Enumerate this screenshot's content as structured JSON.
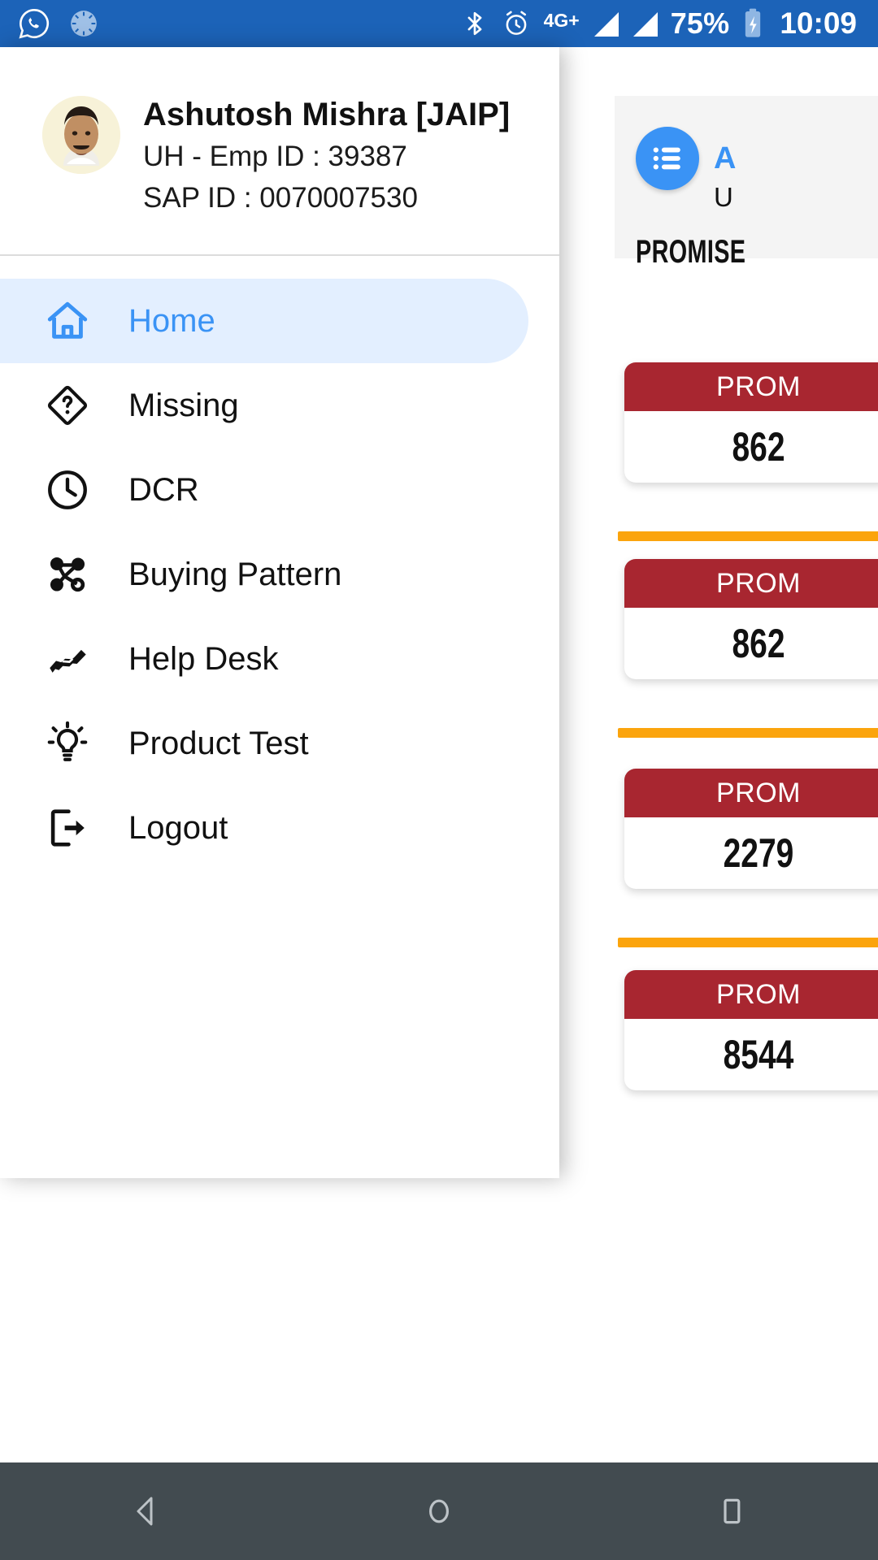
{
  "statusbar": {
    "whatsapp_icon": "whatsapp-icon",
    "spinner_icon": "sync-spinner-icon",
    "bluetooth_icon": "bluetooth-icon",
    "alarm_icon": "alarm-clock-icon",
    "network_type": "4G+",
    "battery_percent": "75%",
    "battery_icon": "battery-charging-icon",
    "clock": "10:09"
  },
  "drawer": {
    "profile": {
      "avatar": "user-avatar",
      "name": "Ashutosh Mishra [JAIP]",
      "emp_line": "UH - Emp ID : 39387",
      "sap_line": "SAP ID : 0070007530"
    },
    "items": [
      {
        "label": "Home",
        "icon": "home-icon",
        "active": true
      },
      {
        "label": "Missing",
        "icon": "help-diamond-icon",
        "active": false
      },
      {
        "label": "DCR",
        "icon": "clock-icon",
        "active": false
      },
      {
        "label": "Buying Pattern",
        "icon": "network-nodes-icon",
        "active": false
      },
      {
        "label": "Help Desk",
        "icon": "handshake-icon",
        "active": false
      },
      {
        "label": "Product Test",
        "icon": "lightbulb-icon",
        "active": false
      },
      {
        "label": "Logout",
        "icon": "logout-icon",
        "active": false
      }
    ]
  },
  "background": {
    "app_card": {
      "list_icon": "list-badge-icon",
      "title": "A",
      "subtitle": "U",
      "section_label": "PROMISE"
    },
    "cards": [
      {
        "header": "PROM",
        "value": "862"
      },
      {
        "header": "PROM",
        "value": "862"
      },
      {
        "header": "PROM",
        "value": "2279"
      },
      {
        "header": "PROM",
        "value": "8544"
      }
    ]
  },
  "navbar": {
    "back": "back-nav-button",
    "home": "home-nav-button",
    "recents": "recents-nav-button"
  },
  "colors": {
    "status_blue": "#1c63b8",
    "accent_blue": "#3a93f5",
    "active_pill": "#e3efff",
    "card_red": "#a82630",
    "divider_orange": "#fba40d",
    "navbar_dark": "#424b50"
  }
}
